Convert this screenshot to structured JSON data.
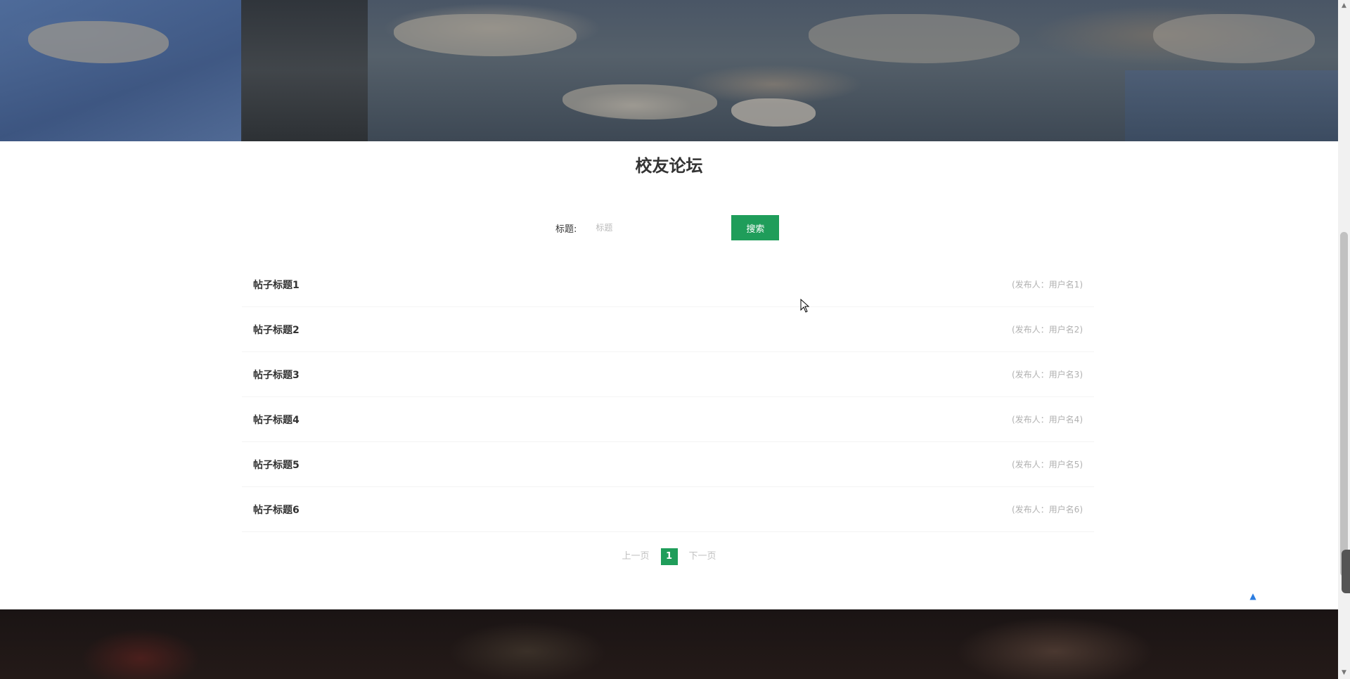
{
  "section": {
    "title": "校友论坛"
  },
  "search": {
    "label": "标题:",
    "placeholder": "标题",
    "button_label": "搜索"
  },
  "posts": [
    {
      "title": "帖子标题1",
      "meta": "(发布人：用户名1)"
    },
    {
      "title": "帖子标题2",
      "meta": "(发布人：用户名2)"
    },
    {
      "title": "帖子标题3",
      "meta": "(发布人：用户名3)"
    },
    {
      "title": "帖子标题4",
      "meta": "(发布人：用户名4)"
    },
    {
      "title": "帖子标题5",
      "meta": "(发布人：用户名5)"
    },
    {
      "title": "帖子标题6",
      "meta": "(发布人：用户名6)"
    }
  ],
  "pagination": {
    "prev_label": "上一页",
    "current": "1",
    "next_label": "下一页"
  },
  "icons": {
    "back_to_top": "triangle-up-icon",
    "scroll_up": "scroll-up-arrow-icon",
    "scroll_down": "scroll-down-arrow-icon"
  },
  "colors": {
    "accent": "#1f9d5a",
    "back_to_top": "#2b7de1"
  }
}
